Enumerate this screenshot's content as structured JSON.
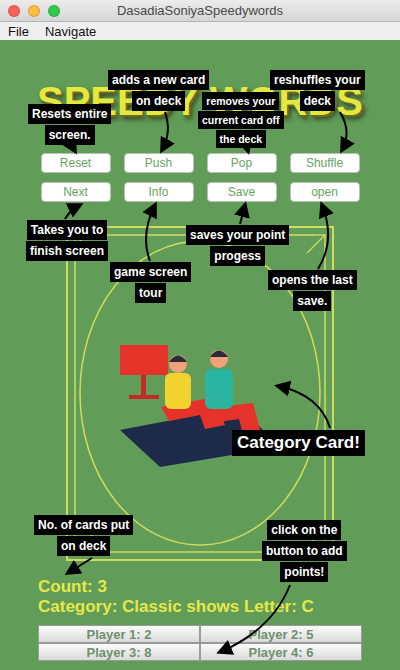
{
  "window": {
    "title": "DasadiaSoniyaSpeedywords"
  },
  "menu": [
    {
      "label": "File"
    },
    {
      "label": "Navigate"
    }
  ],
  "logo": "SPEEDY WORDS",
  "toolbar": {
    "rows": [
      [
        "Reset",
        "Push",
        "Pop",
        "Shuffle"
      ],
      [
        "Next",
        "Info",
        "Save",
        "open"
      ]
    ]
  },
  "status": {
    "count": "Count: 3",
    "category": "Category: Classic shows Letter: C"
  },
  "players": [
    {
      "label": "Player 1: 2"
    },
    {
      "label": "Player 2: 5"
    },
    {
      "label": "Player 3: 8"
    },
    {
      "label": "Player 4: 6"
    }
  ],
  "annotations": [
    {
      "kind": "note",
      "lines": [
        "adds a new card",
        "on deck"
      ]
    },
    {
      "kind": "note",
      "lines": [
        "reshuffles your",
        "deck"
      ]
    },
    {
      "kind": "small",
      "lines": [
        "removes your",
        "current card off",
        "the deck"
      ]
    },
    {
      "kind": "note",
      "lines": [
        "Resets entire",
        "screen."
      ]
    },
    {
      "kind": "note",
      "lines": [
        "Takes you to",
        "finish screen"
      ]
    },
    {
      "kind": "note",
      "lines": [
        "game screen",
        "tour"
      ]
    },
    {
      "kind": "note",
      "lines": [
        "saves your point",
        "progess"
      ]
    },
    {
      "kind": "note",
      "lines": [
        "opens the last",
        "save."
      ]
    },
    {
      "kind": "callout",
      "lines": [
        "Category Card!"
      ]
    },
    {
      "kind": "note",
      "lines": [
        "No. of cards put",
        "on deck"
      ]
    },
    {
      "kind": "note",
      "lines": [
        "click on the",
        "button to add",
        "points!"
      ]
    }
  ]
}
